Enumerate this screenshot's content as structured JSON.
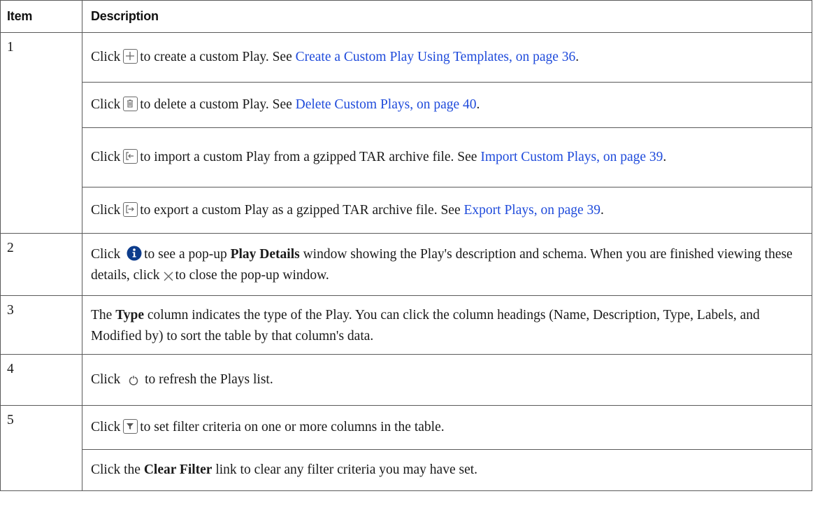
{
  "table": {
    "headers": {
      "item": "Item",
      "description": "Description"
    },
    "rows": [
      {
        "item": "1",
        "click": "Click",
        "icon": "plus-icon",
        "text": "to create a custom Play. See",
        "link": "Create a Custom Play Using Templates, on page 36",
        "end": "."
      },
      {
        "click": "Click",
        "icon": "trash-icon",
        "text": "to delete a custom Play. See",
        "link": "Delete Custom Plays, on page 40",
        "end": "."
      },
      {
        "click": "Click",
        "icon": "import-icon",
        "text": "to import a custom Play from a gzipped TAR archive file. See",
        "link": "Import Custom Plays, on page 39",
        "end": "."
      },
      {
        "click": "Click",
        "icon": "export-icon",
        "text": "to export a custom Play as a gzipped TAR archive file. See",
        "link": "Export Plays, on page 39",
        "end": "."
      },
      {
        "item": "2",
        "click": "Click",
        "icon": "info-icon",
        "text_a": "to see a pop-up",
        "bold": "Play Details",
        "text_b": "window showing the Play's description and schema. When you are finished viewing these details, click",
        "icon2": "close-icon",
        "text_c": "to close the pop-up window."
      },
      {
        "item": "3",
        "text_a": "The",
        "bold": "Type",
        "text_b": "column indicates the type of the Play. You can click the column headings (Name, Description, Type, Labels, and Modified by) to sort the table by that column's data."
      },
      {
        "item": "4",
        "click": "Click",
        "icon": "refresh-icon",
        "text": "to refresh the Plays list."
      },
      {
        "item": "5",
        "click": "Click",
        "icon": "filter-icon",
        "text": "to set filter criteria on one or more columns in the table."
      },
      {
        "text_a": "Click the",
        "bold": "Clear Filter",
        "text_b": "link to clear any filter criteria you may have set."
      }
    ]
  },
  "colors": {
    "link": "#1f4bdb",
    "info_icon": "#0d3c8c",
    "border": "#5a5a5a"
  }
}
